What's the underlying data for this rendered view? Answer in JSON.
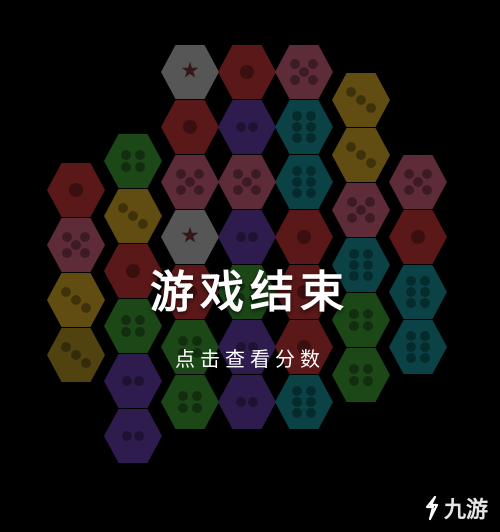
{
  "board": {
    "columns": [
      [
        "red",
        "pink",
        "yellow",
        "olive"
      ],
      [
        "green",
        "yellow",
        "red",
        "green",
        "purple",
        "purple"
      ],
      [
        "gray:star",
        "red",
        "pink",
        "gray:star",
        "red",
        "green",
        "green"
      ],
      [
        "red",
        "purple",
        "pink",
        "purple",
        "green",
        "purple",
        "purple"
      ],
      [
        "pink",
        "teal",
        "teal",
        "red",
        "red",
        "red",
        "teal"
      ],
      [
        "yellow",
        "yellow",
        "pink",
        "teal",
        "green",
        "green"
      ],
      [
        "pink",
        "red",
        "teal",
        "teal"
      ]
    ],
    "colors": {
      "gray": "#d7d7d7",
      "red": "#e33c3c",
      "pink": "#ec6b8e",
      "yellow": "#f3c12c",
      "olive": "#c9a82a",
      "green": "#48b33d",
      "purple": "#7448c6",
      "teal": "#1aa5b0"
    }
  },
  "overlay": {
    "title": "游戏结束",
    "subtitle": "点击查看分数"
  },
  "watermark": {
    "text": "九游",
    "color": "#ffffff"
  }
}
